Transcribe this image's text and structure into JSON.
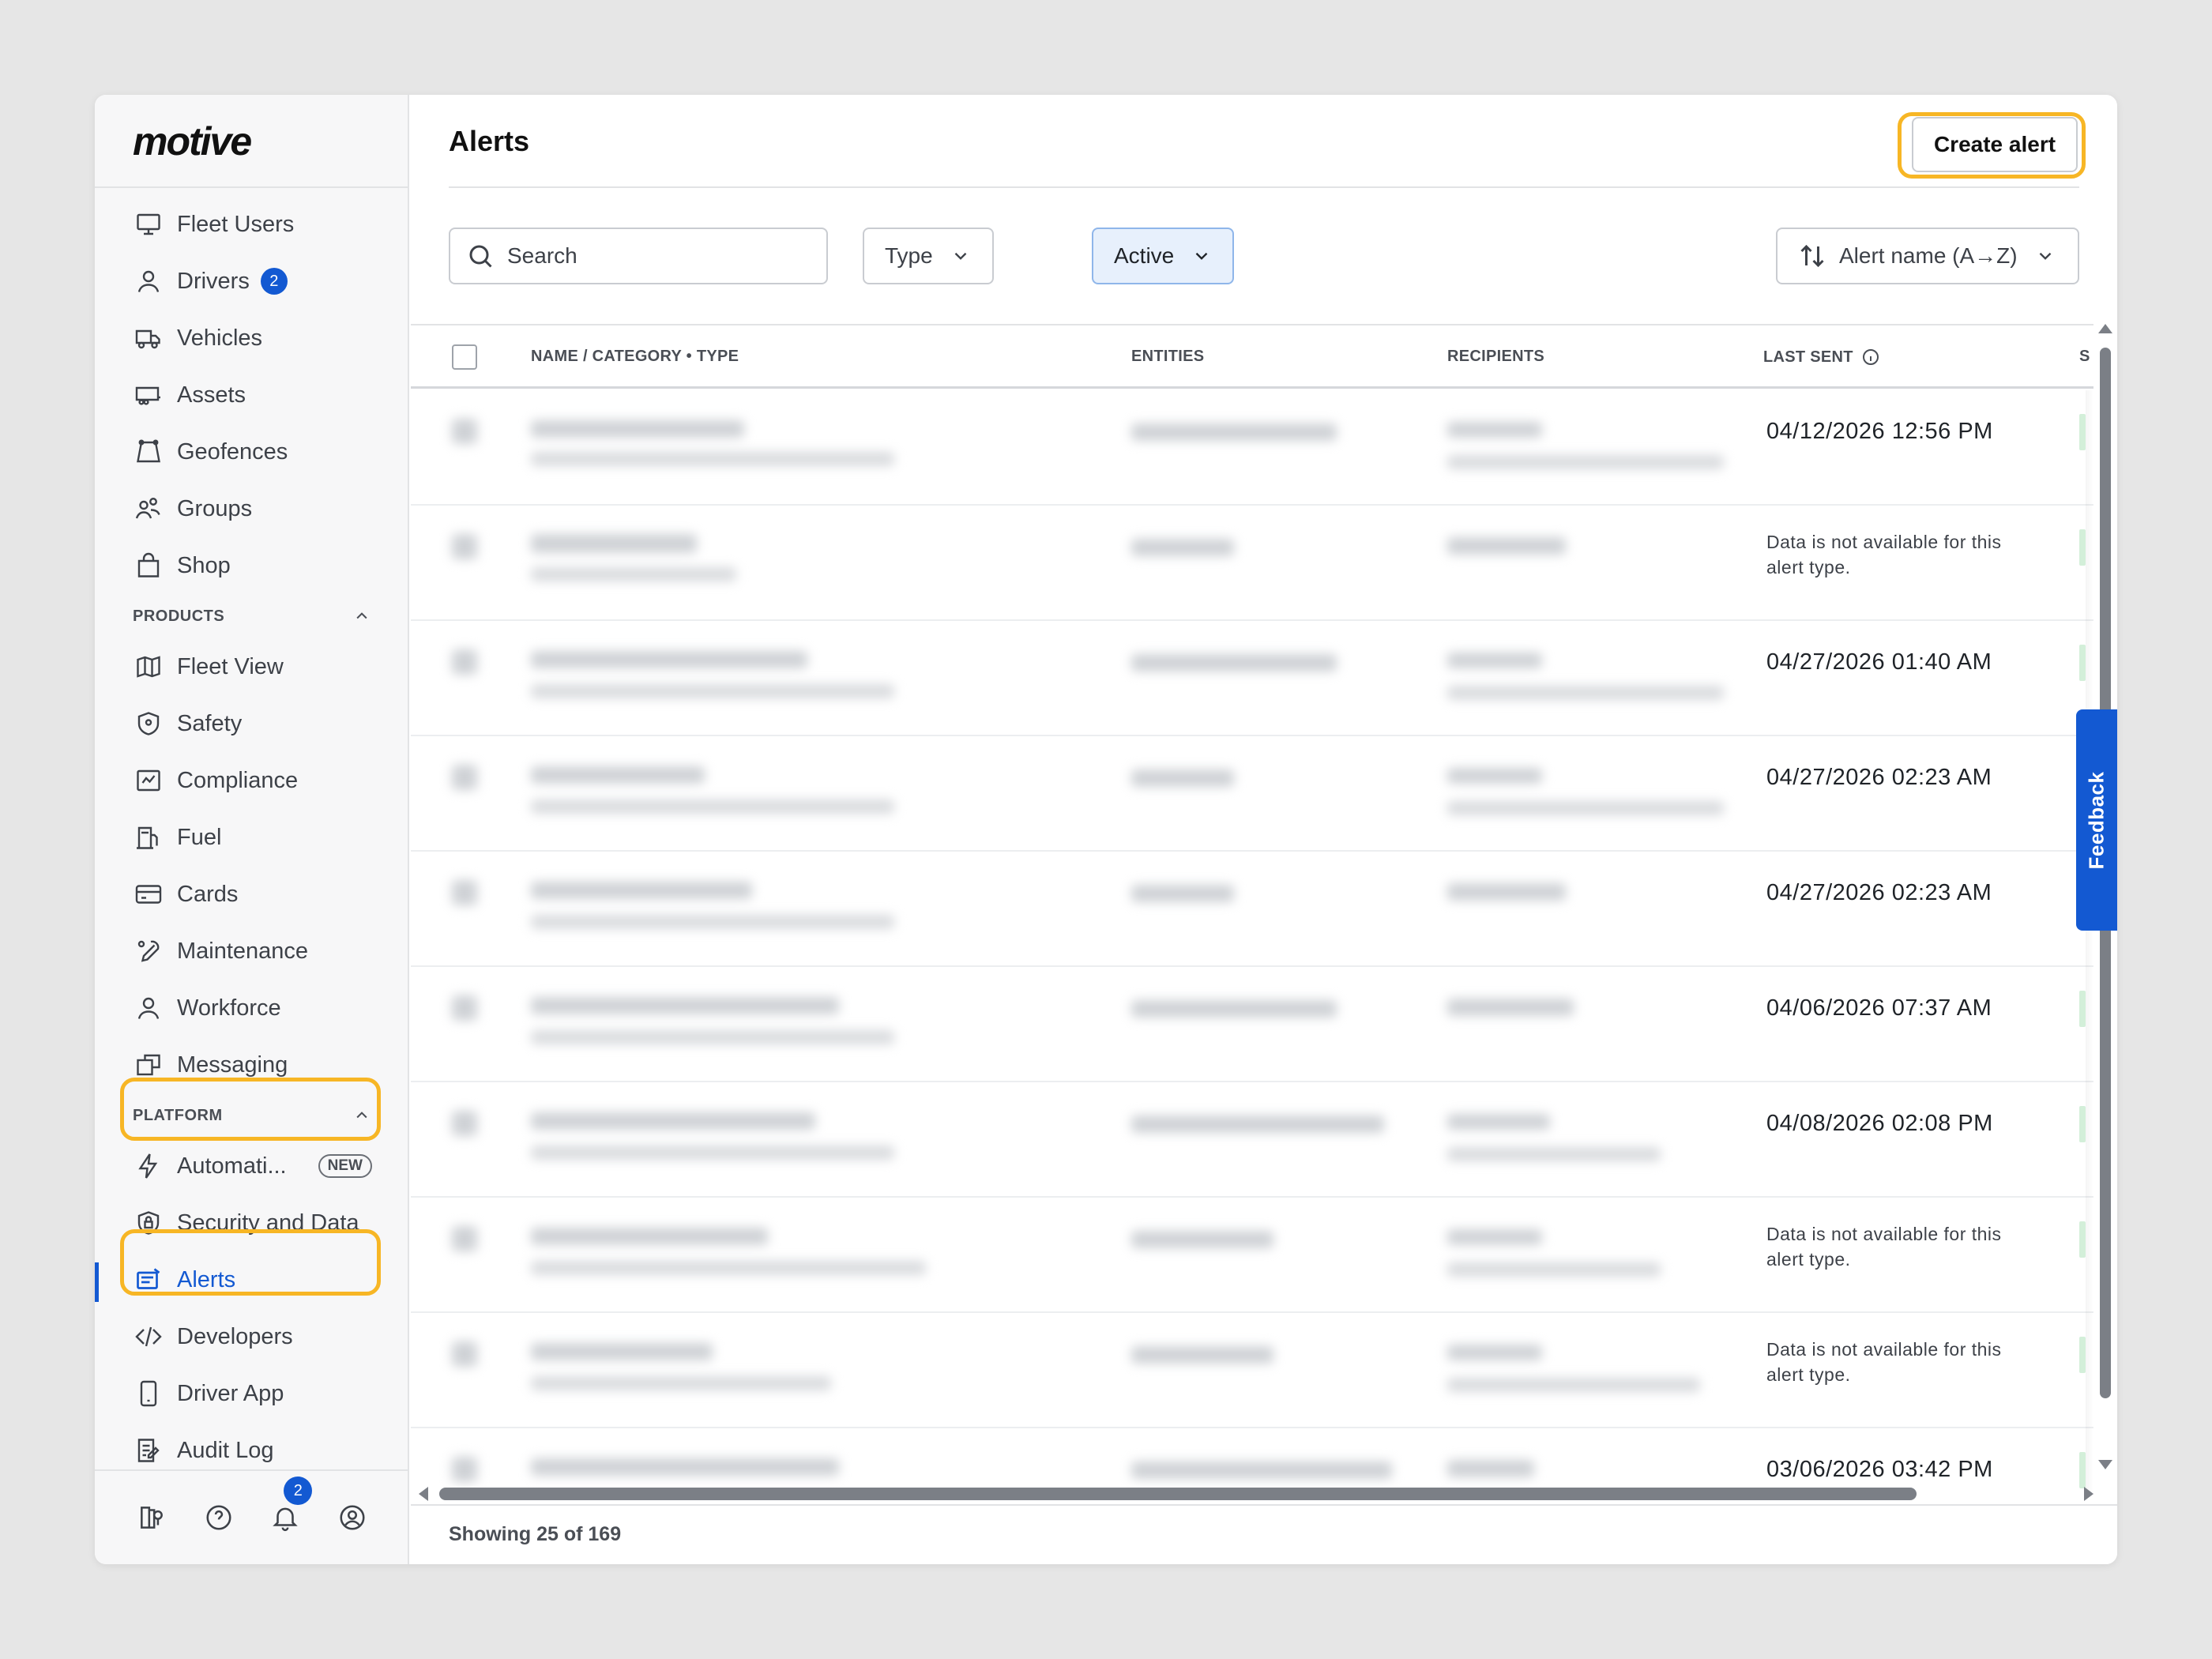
{
  "brand": {
    "logo": "motive"
  },
  "sidebar": {
    "top_items": [
      {
        "label": "Fleet Users",
        "icon": "monitor-icon"
      },
      {
        "label": "Drivers",
        "icon": "user-icon",
        "badge": "2"
      },
      {
        "label": "Vehicles",
        "icon": "truck-icon"
      },
      {
        "label": "Assets",
        "icon": "trailer-icon"
      },
      {
        "label": "Geofences",
        "icon": "geofence-icon"
      },
      {
        "label": "Groups",
        "icon": "groups-icon"
      },
      {
        "label": "Shop",
        "icon": "shopping-bag-icon"
      }
    ],
    "products_label": "PRODUCTS",
    "product_items": [
      {
        "label": "Fleet View",
        "icon": "map-icon"
      },
      {
        "label": "Safety",
        "icon": "shield-icon"
      },
      {
        "label": "Compliance",
        "icon": "compliance-icon"
      },
      {
        "label": "Fuel",
        "icon": "fuel-pump-icon"
      },
      {
        "label": "Cards",
        "icon": "card-icon"
      },
      {
        "label": "Maintenance",
        "icon": "wrench-icon"
      },
      {
        "label": "Workforce",
        "icon": "person-icon"
      },
      {
        "label": "Messaging",
        "icon": "messaging-icon"
      }
    ],
    "platform_label": "PLATFORM",
    "platform_items": [
      {
        "label": "Automati...",
        "icon": "lightning-icon",
        "pill": "NEW"
      },
      {
        "label": "Security and Data",
        "icon": "security-shield-icon"
      },
      {
        "label": "Alerts",
        "icon": "alerts-icon",
        "active": true
      },
      {
        "label": "Developers",
        "icon": "code-icon"
      },
      {
        "label": "Driver App",
        "icon": "phone-icon"
      },
      {
        "label": "Audit Log",
        "icon": "audit-log-icon"
      }
    ],
    "bottom": {
      "notifications_badge": "2"
    }
  },
  "header": {
    "title": "Alerts",
    "create_label": "Create alert"
  },
  "filters": {
    "search_placeholder": "Search",
    "type_label": "Type",
    "status_label": "Active",
    "sort_label": "Alert name (A→Z)"
  },
  "table": {
    "columns": {
      "name": "NAME / CATEGORY • TYPE",
      "entities": "ENTITIES",
      "recipients": "RECIPIENTS",
      "last_sent": "LAST SENT",
      "status": "S"
    },
    "rows": [
      {
        "last_sent": "04/12/2026 12:56 PM"
      },
      {
        "last_sent": "Data is not available for this alert type.",
        "na": true
      },
      {
        "last_sent": "04/27/2026 01:40 AM"
      },
      {
        "last_sent": "04/27/2026 02:23 AM"
      },
      {
        "last_sent": "04/27/2026 02:23 AM"
      },
      {
        "last_sent": "04/06/2026 07:37 AM"
      },
      {
        "last_sent": "04/08/2026 02:08 PM"
      },
      {
        "last_sent": "Data is not available for this alert type.",
        "na": true
      },
      {
        "last_sent": "Data is not available for this alert type.",
        "na": true
      },
      {
        "last_sent": "03/06/2026 03:42 PM"
      }
    ],
    "more_label": "···"
  },
  "footer": {
    "showing": "Showing 25 of 169"
  },
  "feedback": {
    "label": "Feedback"
  },
  "colors": {
    "accent": "#1359d2",
    "highlight": "#f7b625",
    "active_filter_bg": "#e7f0fc"
  }
}
